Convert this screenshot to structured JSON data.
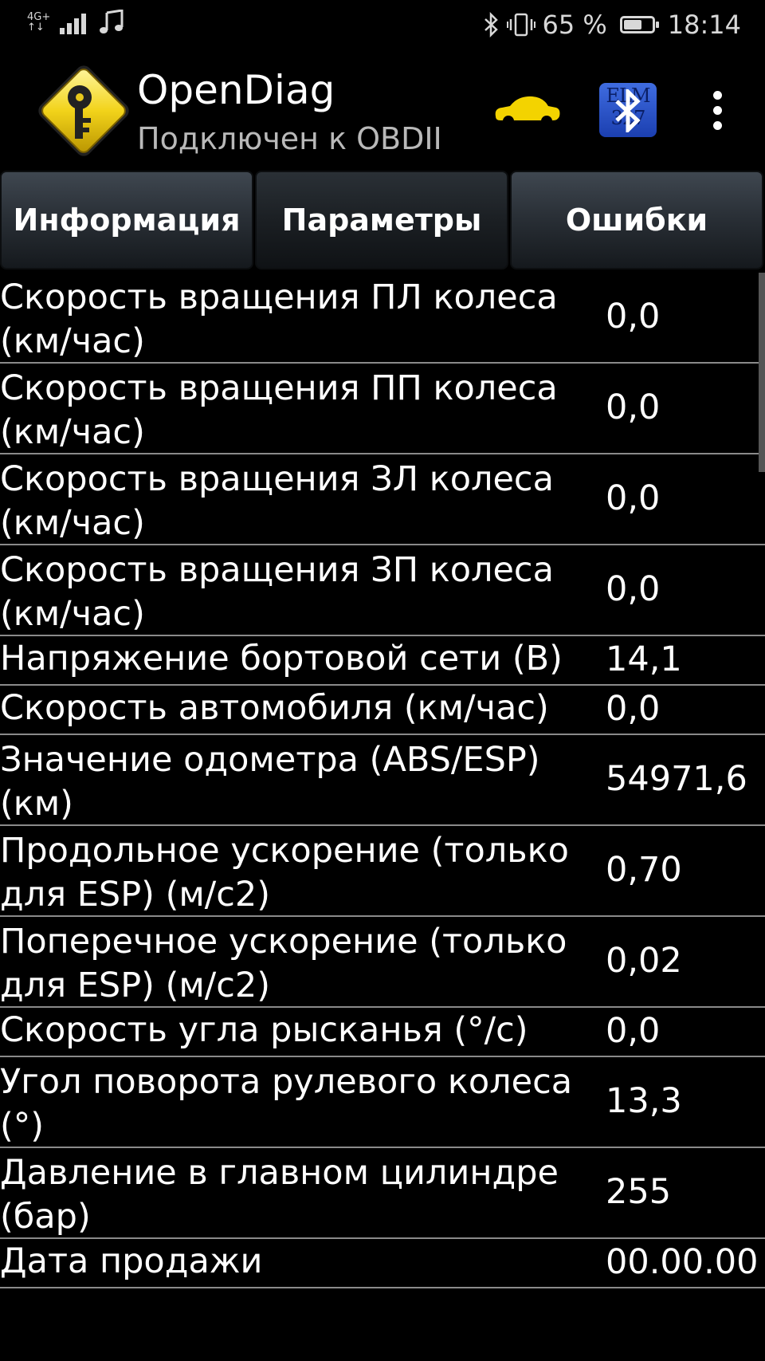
{
  "status_bar": {
    "network_label_top": "4G+",
    "network_label_bottom": "↑↓",
    "battery_percent": "65 %",
    "battery_level": 0.65,
    "time": "18:14"
  },
  "app_bar": {
    "title": "OpenDiag",
    "subtitle": "Подключен к OBDII",
    "elm_label_top": "ELM",
    "elm_label_bottom": "327"
  },
  "tabs": [
    {
      "label": "Информация",
      "active": false
    },
    {
      "label": "Параметры",
      "active": true
    },
    {
      "label": "Ошибки",
      "active": false
    }
  ],
  "parameters": [
    {
      "name_l1": "Скорость вращения ПЛ колеса",
      "name_l2": "(км/час)",
      "value": "0,0"
    },
    {
      "name_l1": "Скорость вращения ПП колеса",
      "name_l2": "(км/час)",
      "value": "0,0"
    },
    {
      "name_l1": "Скорость вращения ЗЛ колеса",
      "name_l2": "(км/час)",
      "value": "0,0"
    },
    {
      "name_l1": "Скорость вращения ЗП колеса",
      "name_l2": "(км/час)",
      "value": "0,0"
    },
    {
      "name_l1": "Напряжение бортовой сети (В)",
      "name_l2": "",
      "value": "14,1"
    },
    {
      "name_l1": "Скорость автомобиля (км/час)",
      "name_l2": "",
      "value": "0,0"
    },
    {
      "name_l1": "Значение одометра (ABS/ESP)",
      "name_l2": "(км)",
      "value": "54971,6"
    },
    {
      "name_l1": "Продольное ускорение (только",
      "name_l2": "для ESP) (м/с2)",
      "value": "0,70"
    },
    {
      "name_l1": "Поперечное ускорение (только",
      "name_l2": "для ESP) (м/с2)",
      "value": "0,02"
    },
    {
      "name_l1": "Скорость угла рысканья (°/с)",
      "name_l2": "",
      "value": "0,0"
    },
    {
      "name_l1": "Угол поворота рулевого колеса",
      "name_l2": "(°)",
      "value": "13,3"
    },
    {
      "name_l1": "Давление в главном цилиндре",
      "name_l2": "(бар)",
      "value": "255"
    },
    {
      "name_l1": "Дата продажи",
      "name_l2": "",
      "value": "00.00.00"
    }
  ]
}
